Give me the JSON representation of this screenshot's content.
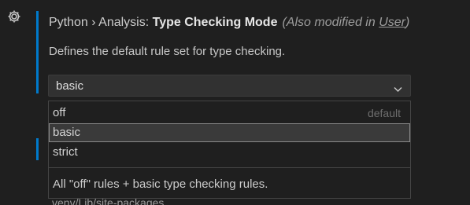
{
  "setting": {
    "category": "Python › Analysis: ",
    "name": "Type Checking Mode",
    "modified_prefix": "(Also modified in ",
    "modified_link": "User",
    "modified_suffix": ")",
    "description": "Defines the default rule set for type checking."
  },
  "select": {
    "value": "basic",
    "options": [
      {
        "label": "off",
        "hint": "default"
      },
      {
        "label": "basic",
        "hint": ""
      },
      {
        "label": "strict",
        "hint": ""
      }
    ],
    "selected_index": 1,
    "option_description": "All \"off\" rules + basic type checking rules."
  },
  "background_text": "venv/Lib/site-packages",
  "colors": {
    "accent": "#007acc",
    "background": "#1f1f1f"
  },
  "icons": {
    "settings": "gear-icon",
    "dropdown": "chevron-down-icon"
  }
}
